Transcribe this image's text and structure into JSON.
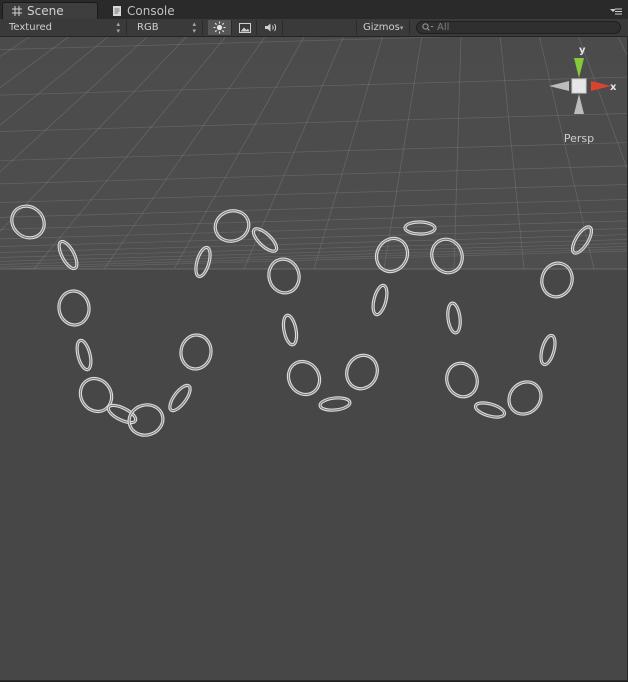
{
  "tabs": [
    {
      "label": "Scene",
      "icon": "grid-icon",
      "active": true
    },
    {
      "label": "Console",
      "icon": "console-icon",
      "active": false
    }
  ],
  "toolbar": {
    "draw_mode": "Textured",
    "render_mode": "RGB",
    "lighting_icon": "sun-icon",
    "image_icon": "image-icon",
    "audio_icon": "audio-icon",
    "gizmos_label": "Gizmos",
    "search_placeholder": "All"
  },
  "scene": {
    "projection_label": "Persp",
    "axis_labels": {
      "x": "x",
      "y": "y"
    },
    "colors": {
      "background": "#474747",
      "grid": "#9a9a9a",
      "x_axis": "#d9442f",
      "y_axis": "#86c93a",
      "chain": "#dcdcdc"
    }
  }
}
